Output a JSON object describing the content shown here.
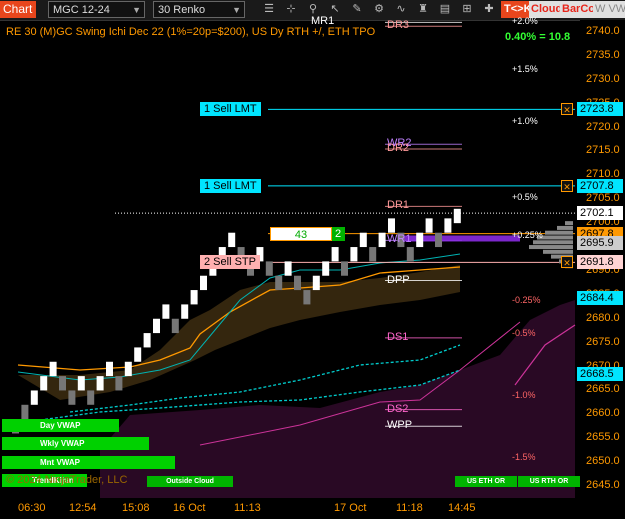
{
  "toolbar": {
    "chart_tab": "Chart",
    "instrument": "MGC 12-24",
    "bar_type": "30 Renko",
    "tk_label": "T<>K",
    "cloud_label": "Cloud",
    "barcol_label": "BarCol",
    "vwap_label": "W VWAP",
    "icons": [
      "menu-icon",
      "crosshair-icon",
      "zoom-icon",
      "pointer-icon",
      "draw-icon",
      "properties-icon",
      "indicators-icon",
      "strategy-icon",
      "data-box-icon",
      "templates-icon",
      "grid-icon",
      "layout-icon",
      "add-icon"
    ]
  },
  "title": "RE 30 (M)GC Swing Ichi Dec 22 (1%=20p=$200), US Dy RTH +/, ETH TPO",
  "perf_text": "0.40% = 10.8",
  "price_axis": {
    "ticks": [
      "2740.0",
      "2735.0",
      "2730.0",
      "2725.0",
      "2720.0",
      "2715.0",
      "2710.0",
      "2705.0",
      "2700.0",
      "2695.0",
      "2690.0",
      "2685.0",
      "2680.0",
      "2675.0",
      "2670.0",
      "2665.0",
      "2660.0",
      "2655.0",
      "2650.0",
      "2645.0"
    ],
    "min": 2642.5,
    "max": 2742.5
  },
  "price_labels": [
    {
      "text": "2723.8",
      "value": 2723.8,
      "color": "#00e5ff"
    },
    {
      "text": "2707.8",
      "value": 2707.8,
      "color": "#00e5ff"
    },
    {
      "text": "2702.1",
      "value": 2702.1,
      "color": "#ffffff"
    },
    {
      "text": "2697.8",
      "value": 2697.8,
      "color": "#ff9900"
    },
    {
      "text": "2695.9",
      "value": 2695.9,
      "color": "#cccccc"
    },
    {
      "text": "2691.8",
      "value": 2691.8,
      "color": "#ffd4d4"
    },
    {
      "text": "2684.4",
      "value": 2684.4,
      "color": "#00e5ff"
    },
    {
      "text": "2668.5",
      "value": 2668.5,
      "color": "#00e5ff"
    }
  ],
  "orders": [
    {
      "text": "1 Sell LMT",
      "value": 2723.8,
      "color": "#00e5ff"
    },
    {
      "text": "1 Sell LMT",
      "value": 2707.8,
      "color": "#00e5ff"
    },
    {
      "text": "2 Sell STP",
      "value": 2691.8,
      "color": "#ffb0b0"
    }
  ],
  "position": {
    "pnl": "43",
    "qty": "2",
    "value": 2697.8
  },
  "pivots": [
    {
      "text": "MR1",
      "value": 2742.0,
      "color": "#ffffff"
    },
    {
      "text": "DR3",
      "value": 2741.2,
      "color": "#ff9999"
    },
    {
      "text": "WR2",
      "value": 2716.5,
      "color": "#c080ff"
    },
    {
      "text": "DR2",
      "value": 2715.5,
      "color": "#ff9999"
    },
    {
      "text": "DR1",
      "value": 2703.5,
      "color": "#ff9999"
    },
    {
      "text": "WR1",
      "value": 2696.4,
      "color": "#c080ff"
    },
    {
      "text": "DPP",
      "value": 2688.0,
      "color": "#ffffff"
    },
    {
      "text": "DS1",
      "value": 2676.0,
      "color": "#ff66cc"
    },
    {
      "text": "DS2",
      "value": 2661.0,
      "color": "#ff66cc"
    },
    {
      "text": "WPP",
      "value": 2657.5,
      "color": "#ffffff"
    }
  ],
  "pct_labels": [
    {
      "text": "+2.0%",
      "value": 2742.3,
      "color": "#ffffff"
    },
    {
      "text": "+1.5%",
      "value": 2732.2,
      "color": "#ffffff"
    },
    {
      "text": "+1.0%",
      "value": 2721.4,
      "color": "#ffffff"
    },
    {
      "text": "+0.5%",
      "value": 2705.5,
      "color": "#ffffff"
    },
    {
      "text": "+0.25%",
      "value": 2697.5,
      "color": "#ffffff"
    },
    {
      "text": "-0.25%",
      "value": 2684.0,
      "color": "#ff6666"
    },
    {
      "text": "-0.5%",
      "value": 2677.0,
      "color": "#ff6666"
    },
    {
      "text": "-1.0%",
      "value": 2664.0,
      "color": "#ff6666"
    },
    {
      "text": "-1.5%",
      "value": 2651.0,
      "color": "#ff6666"
    }
  ],
  "green_bars": [
    {
      "text": "Day VWAP",
      "width": 117
    },
    {
      "text": "Wkly VWAP",
      "width": 147
    },
    {
      "text": "Mnt VWAP",
      "width": 173
    },
    {
      "text": "TrendKijun",
      "width": 85
    }
  ],
  "bottom_boxes": [
    {
      "text": "Outside Cloud"
    },
    {
      "text": "US ETH OR"
    },
    {
      "text": "US RTH OR"
    }
  ],
  "copyright": "© 2024 NinjaTrader, LLC",
  "x_axis": [
    "06:30",
    "12:54",
    "15:08",
    "16 Oct",
    "11:13",
    "17 Oct",
    "11:18",
    "14:45"
  ],
  "chart_data": {
    "type": "renko",
    "brick_size": 3.0,
    "bricks": [
      {
        "dir": "down",
        "low": 2656
      },
      {
        "dir": "down",
        "low": 2659
      },
      {
        "dir": "up",
        "low": 2662
      },
      {
        "dir": "up",
        "low": 2665
      },
      {
        "dir": "up",
        "low": 2668
      },
      {
        "dir": "down",
        "low": 2665
      },
      {
        "dir": "down",
        "low": 2662
      },
      {
        "dir": "up",
        "low": 2665
      },
      {
        "dir": "down",
        "low": 2662
      },
      {
        "dir": "up",
        "low": 2665
      },
      {
        "dir": "up",
        "low": 2668
      },
      {
        "dir": "down",
        "low": 2665
      },
      {
        "dir": "up",
        "low": 2668
      },
      {
        "dir": "up",
        "low": 2671
      },
      {
        "dir": "up",
        "low": 2674
      },
      {
        "dir": "up",
        "low": 2677
      },
      {
        "dir": "up",
        "low": 2680
      },
      {
        "dir": "down",
        "low": 2677
      },
      {
        "dir": "up",
        "low": 2680
      },
      {
        "dir": "up",
        "low": 2683
      },
      {
        "dir": "up",
        "low": 2686
      },
      {
        "dir": "up",
        "low": 2689
      },
      {
        "dir": "up",
        "low": 2692
      },
      {
        "dir": "up",
        "low": 2695
      },
      {
        "dir": "down",
        "low": 2692
      },
      {
        "dir": "down",
        "low": 2689
      },
      {
        "dir": "up",
        "low": 2692
      },
      {
        "dir": "down",
        "low": 2689
      },
      {
        "dir": "down",
        "low": 2686
      },
      {
        "dir": "up",
        "low": 2689
      },
      {
        "dir": "down",
        "low": 2686
      },
      {
        "dir": "down",
        "low": 2683
      },
      {
        "dir": "up",
        "low": 2686
      },
      {
        "dir": "up",
        "low": 2689
      },
      {
        "dir": "up",
        "low": 2692
      },
      {
        "dir": "down",
        "low": 2689
      },
      {
        "dir": "up",
        "low": 2692
      },
      {
        "dir": "up",
        "low": 2695
      },
      {
        "dir": "down",
        "low": 2692
      },
      {
        "dir": "up",
        "low": 2695
      },
      {
        "dir": "up",
        "low": 2698
      },
      {
        "dir": "down",
        "low": 2695
      },
      {
        "dir": "down",
        "low": 2692
      },
      {
        "dir": "up",
        "low": 2695
      },
      {
        "dir": "up",
        "low": 2698
      },
      {
        "dir": "down",
        "low": 2695
      },
      {
        "dir": "up",
        "low": 2698
      },
      {
        "dir": "up",
        "low": 2700
      }
    ]
  }
}
